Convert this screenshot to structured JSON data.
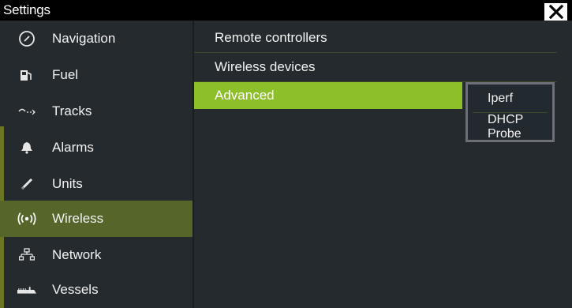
{
  "window": {
    "title": "Settings"
  },
  "sidebar": {
    "items": [
      {
        "label": "Navigation",
        "icon": "compass-icon"
      },
      {
        "label": "Fuel",
        "icon": "fuel-pump-icon"
      },
      {
        "label": "Tracks",
        "icon": "tracks-icon"
      },
      {
        "label": "Alarms",
        "icon": "bell-icon"
      },
      {
        "label": "Units",
        "icon": "ruler-icon"
      },
      {
        "label": "Wireless",
        "icon": "wireless-icon",
        "selected": true
      },
      {
        "label": "Network",
        "icon": "network-icon"
      },
      {
        "label": "Vessels",
        "icon": "vessels-icon"
      }
    ]
  },
  "main": {
    "items": [
      {
        "label": "Remote controllers"
      },
      {
        "label": "Wireless devices"
      },
      {
        "label": "Advanced",
        "selected": true
      }
    ]
  },
  "submenu": {
    "items": [
      {
        "label": "Iperf"
      },
      {
        "label": "DHCP Probe"
      }
    ]
  },
  "colors": {
    "selected_sidebar": "#56652a",
    "selected_main": "#8cbf2a",
    "panel_bg": "#252a2e"
  }
}
